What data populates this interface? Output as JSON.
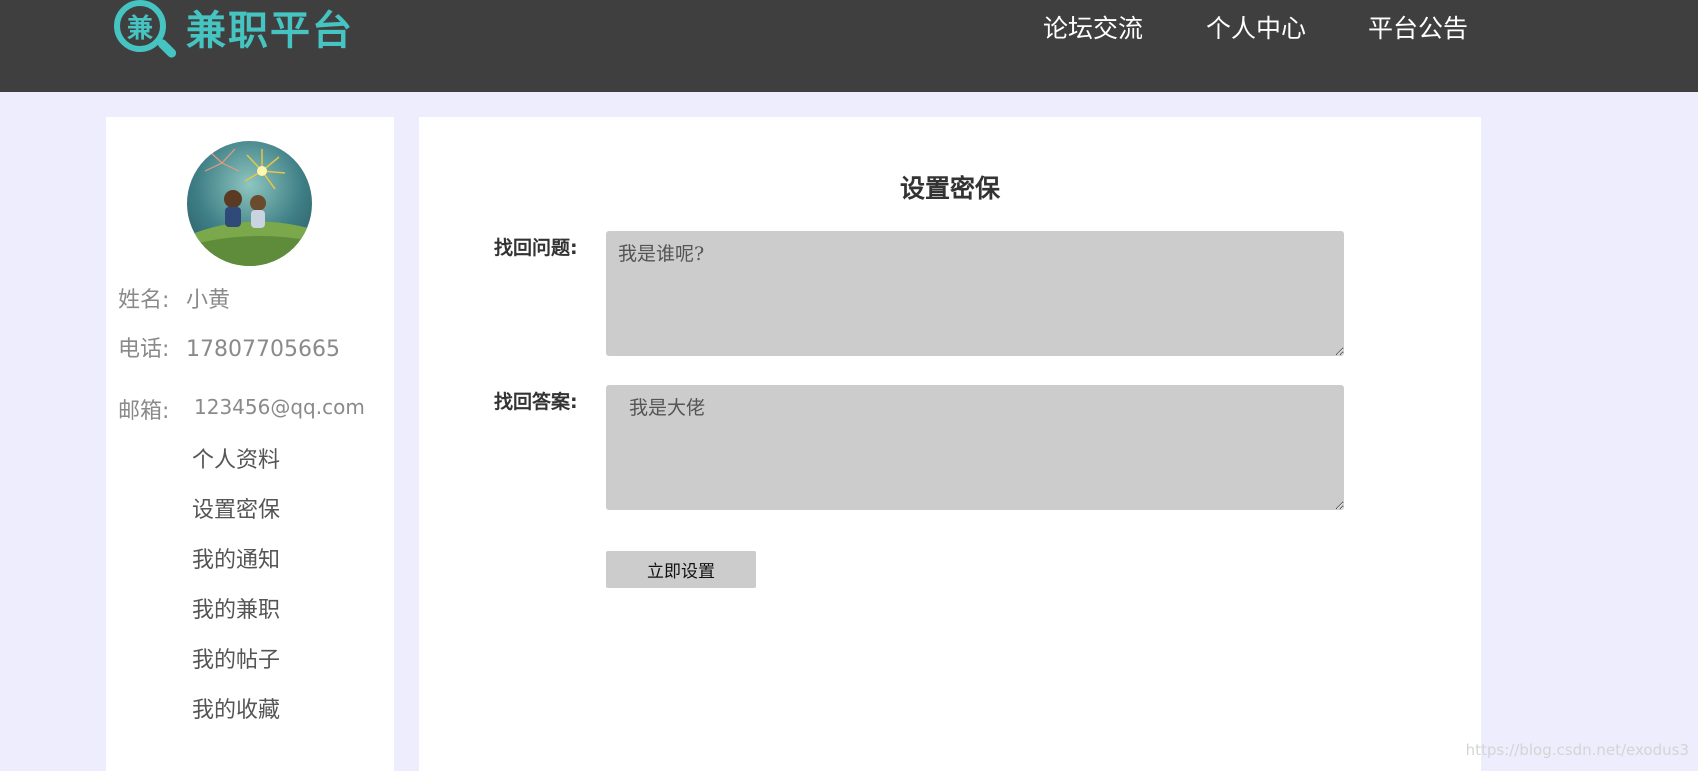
{
  "header": {
    "logo_char": "兼",
    "logo_text": "兼职平台",
    "nav": [
      "论坛交流",
      "个人中心",
      "平台公告"
    ]
  },
  "profile": {
    "name_label": "姓名:",
    "name": "小黄",
    "phone_label": "电话:",
    "phone": "17807705665",
    "email_label": "邮箱:",
    "email": "123456@qq.com"
  },
  "menu": [
    "个人资料",
    "设置密保",
    "我的通知",
    "我的兼职",
    "我的帖子",
    "我的收藏"
  ],
  "form": {
    "title": "设置密保",
    "question_label": "找回问题:",
    "question_value": "我是谁呢?",
    "answer_label": "找回答案:",
    "answer_value": "我是大佬",
    "submit_label": "立即设置"
  },
  "watermark": "https://blog.csdn.net/exodus3",
  "colors": {
    "header_bg": "#3f3f3f",
    "brand": "#45c4c2",
    "page_bg": "#eeedfd",
    "input_bg": "#cccccc"
  }
}
